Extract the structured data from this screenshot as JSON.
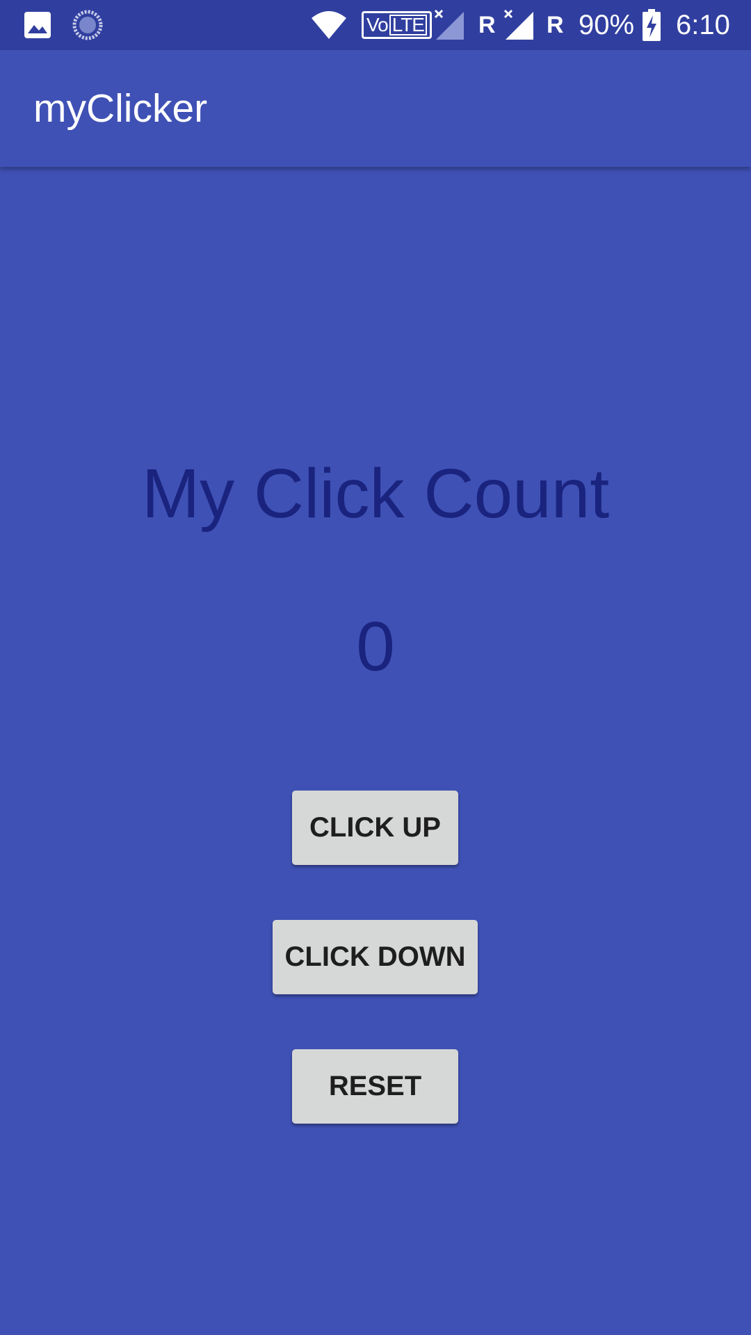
{
  "status_bar": {
    "icons": [
      "image-icon",
      "sync-icon",
      "wifi-icon",
      "volte-icon",
      "signal-icon",
      "signal-icon"
    ],
    "volte_prefix": "Vo",
    "volte_suffix": "LTE",
    "roaming_1": "R",
    "roaming_2": "R",
    "battery": "90%",
    "time": "6:10"
  },
  "app_bar": {
    "title": "myClicker"
  },
  "main": {
    "heading": "My Click Count",
    "count": "0",
    "buttons": {
      "click_up": "CLICK UP",
      "click_down": "CLICK DOWN",
      "reset": "RESET"
    }
  },
  "colors": {
    "primary": "#3f51b5",
    "primary_dark": "#303f9f",
    "text_dark": "#1a237e",
    "button": "#d6d7d7"
  }
}
